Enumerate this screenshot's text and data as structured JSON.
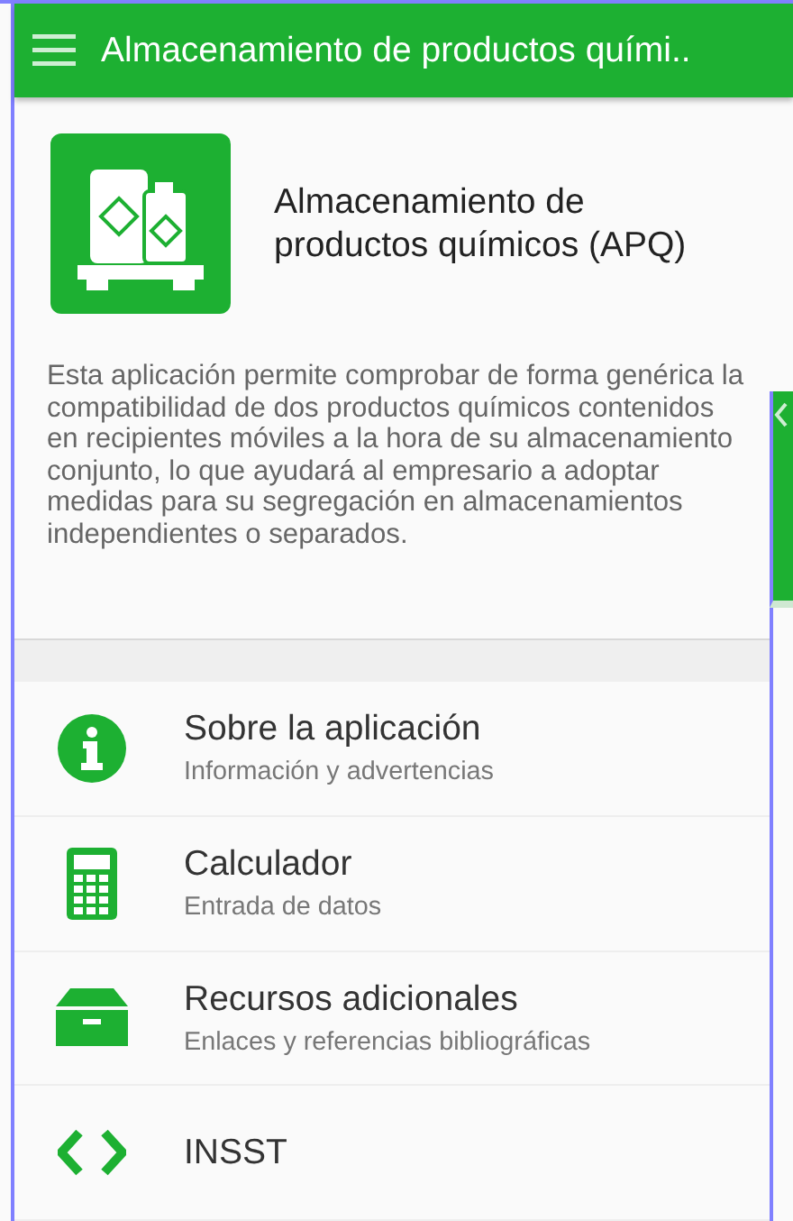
{
  "app_bar": {
    "title": "Almacenamiento de productos quími.."
  },
  "header": {
    "title": "Almacenamiento de productos químicos (APQ)",
    "description": "Esta aplicación permite comprobar de forma genérica la compatibilidad de dos productos químicos contenidos en recipientes móviles a la hora de su almacenamiento conjunto, lo que ayudará al empresario a adoptar medidas para su segregación en almacenamientos independientes o separados."
  },
  "menu": [
    {
      "kind": "info",
      "title": "Sobre la aplicación",
      "subtitle": "Información y advertencias"
    },
    {
      "kind": "calculator",
      "title": "Calculador",
      "subtitle": "Entrada de datos"
    },
    {
      "kind": "archive",
      "title": "Recursos adicionales",
      "subtitle": "Enlaces y referencias bibliográficas"
    },
    {
      "kind": "code",
      "title": "INSST"
    }
  ]
}
